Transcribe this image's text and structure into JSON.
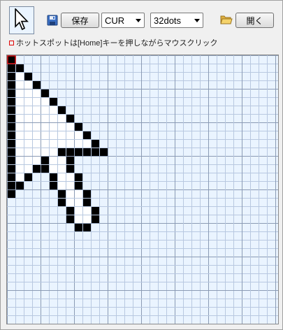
{
  "toolbar": {
    "save_label": "保存",
    "format_value": "CUR",
    "size_value": "32dots",
    "open_label": "開く"
  },
  "hint": {
    "text": "ホットスポットは[Home]キーを押しながらマウスクリック"
  },
  "editor": {
    "grid_size": 32,
    "hotspot": [
      0,
      0
    ],
    "colors": {
      "background": "#eaf4ff",
      "grid_minor": "#b8c8e0",
      "grid_major": "#8b9bb4",
      "black": "#000000",
      "white": "#ffffff",
      "hotspot": "#cc0000"
    },
    "pixels": [
      "X",
      "XX",
      "XWX",
      "XWWX",
      "XWWWX",
      "XWWWWX",
      "XWWWWWX",
      "XWWWWWWX",
      "XWWWWWWWX",
      "XWWWWWWWWX",
      "XWWWWWWWWWX",
      "XWWWWWXXXXXX",
      "XWWWXWWX",
      "XWWXXWWX",
      "XWX  XWWX",
      "XX   XWWX",
      "X     XWWX",
      "      XWWX",
      "       XWWX",
      "       XWWX",
      "        XX"
    ]
  },
  "icons": {
    "preview": "cursor-preview-icon",
    "save": "floppy-disk-icon",
    "open": "folder-open-icon"
  }
}
